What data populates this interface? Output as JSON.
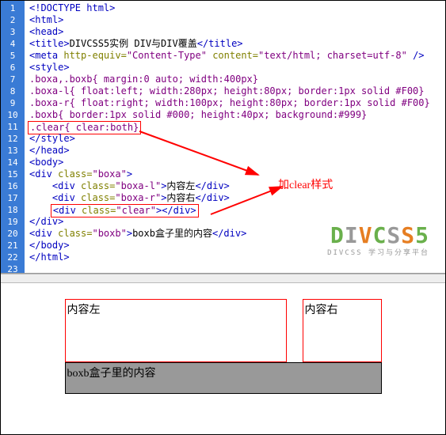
{
  "code": {
    "l1": "<!DOCTYPE html>",
    "l2": "<html>",
    "l3": "<head>",
    "l4a": "<title>",
    "l4b": "DIVCSS5实例 DIV与DIV覆盖",
    "l4c": "</title>",
    "l5a": "<meta",
    "l5b": " http-equiv=",
    "l5c": "\"Content-Type\"",
    "l5d": " content=",
    "l5e": "\"text/html; charset=utf-8\"",
    "l5f": " />",
    "l6": "<style>",
    "l7a": ".boxa,.boxb{",
    "l7b": " margin:0 auto; width:400px}",
    "l8a": ".boxa-l{",
    "l8b": " float:left; width:280px; height:80px; border:1px solid #F00}",
    "l9a": ".boxa-r{",
    "l9b": " float:right; width:100px; height:80px; border:1px solid #F00}",
    "l10a": ".boxb{",
    "l10b": " border:1px solid #000; height:40px; background:#999}",
    "l11a": ".clear{",
    "l11b": " clear:both}",
    "l12": "</style>",
    "l13": "</head>",
    "l14": "<body>",
    "l15a": "<div",
    "l15b": " class=",
    "l15c": "\"boxa\"",
    "l15d": ">",
    "l16a": "<div",
    "l16b": " class=",
    "l16c": "\"boxa-l\"",
    "l16d": ">",
    "l16e": "内容左",
    "l16f": "</div>",
    "l17a": "<div",
    "l17b": " class=",
    "l17c": "\"boxa-r\"",
    "l17d": ">",
    "l17e": "内容右",
    "l17f": "</div>",
    "l18a": "<div",
    "l18b": " class=",
    "l18c": "\"clear\"",
    "l18d": ">",
    "l18e": "</div>",
    "l19": "</div>",
    "l20a": "<div",
    "l20b": " class=",
    "l20c": "\"boxb\"",
    "l20d": ">",
    "l20e": "boxb盒子里的内容",
    "l20f": "</div>",
    "l21": "</body>",
    "l22": "</html>"
  },
  "annotation": "加clear样式",
  "logo": {
    "text_d": "D",
    "text_i": "I",
    "text_v": "V",
    "text_c": "C",
    "text_s1": "S",
    "text_s2": "S",
    "text_5": "5",
    "sub": "DIVCSS 学习与分享平台"
  },
  "preview": {
    "left": "内容左",
    "right": "内容右",
    "boxb": "boxb盒子里的内容"
  }
}
